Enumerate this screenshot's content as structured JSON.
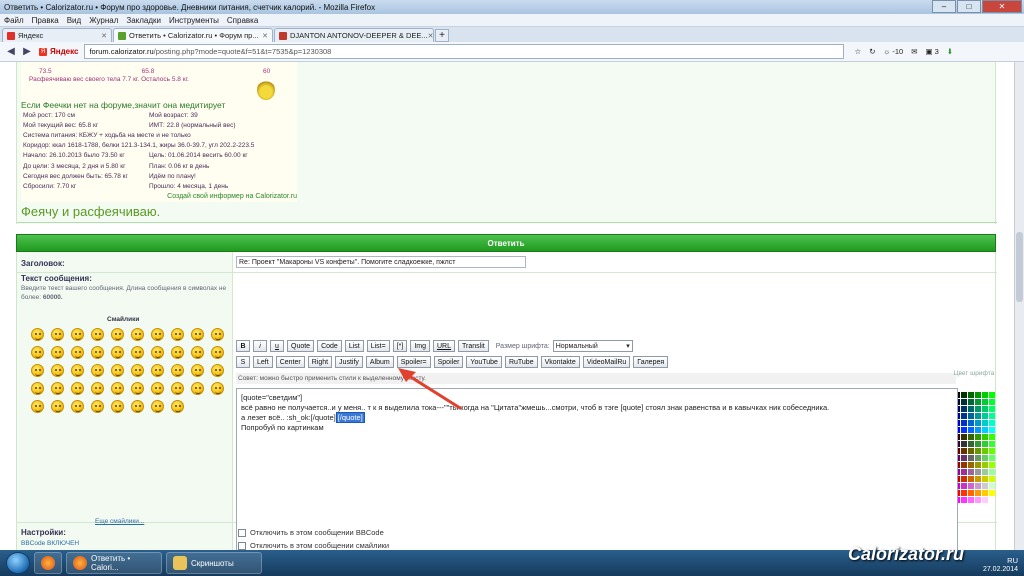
{
  "window": {
    "title": "Ответить • Calorizator.ru • Форум про здоровье. Дневники питания, счетчик калорий. - Mozilla Firefox"
  },
  "menu": [
    "Файл",
    "Правка",
    "Вид",
    "Журнал",
    "Закладки",
    "Инструменты",
    "Справка"
  ],
  "tabs": [
    {
      "label": "Яндекс",
      "favicon_color": "#e0302a"
    },
    {
      "label": "Ответить • Calorizator.ru • Форум пр...",
      "favicon_color": "#5aa02c"
    },
    {
      "label": "DJANTON ANTONOV-DEEPER & DEE...",
      "favicon_color": "#c0392b"
    }
  ],
  "nav": {
    "yandex_label": "Яндекс",
    "url_domain": "forum.calorizator.ru",
    "url_path": "/posting.php?mode=quote&f=51&t=7535&p=1230308",
    "weather": "-10",
    "counter": "3"
  },
  "informer": {
    "scale_left": "73.5",
    "scale_mid": "65.8",
    "scale_right": "60",
    "lose_note": "Расфеячиваю вес своего тела 7.7 кг. Осталось 5.8 кг.",
    "headline": "Если Феечки нет на форуме,значит она медитирует",
    "rows": [
      {
        "l": "Мой рост: 170 см",
        "r": "Мой возраст: 39"
      },
      {
        "l": "Мой текущий вес: 65.8 кг",
        "r": "ИМТ: 22.8 (нормальный вес)"
      },
      {
        "l": "Система питания: КБЖУ + ходьба на месте и не только",
        "r": ""
      },
      {
        "l": "Коридор: ккал 1618-1788, белки 121.3-134.1, жиры 36.0-39.7, угл 202.2-223.5",
        "r": ""
      },
      {
        "l": "Начало: 26.10.2013 было 73.50 кг",
        "r": "Цель: 01.06.2014 весить 60.00 кг"
      },
      {
        "l": "До цели: 3 месяца, 2 дня и 5.80 кг",
        "r": "План: 0.06 кг в день"
      },
      {
        "l": "Сегодня вес должен быть: 65.78 кг",
        "r": "Идём по плану!"
      },
      {
        "l": "Сбросили: 7.70 кг",
        "r": "Прошло: 4 месяца, 1 день"
      }
    ],
    "footer_link": "Создай свой информер на Calorizator.ru"
  },
  "signature_text": "Феячу и расфеячиваю.",
  "reply_header": "Ответить",
  "form": {
    "subject_label": "Заголовок:",
    "subject_value": "Re: Проект \"Макароны VS конфеты\". Помогите сладкоежке, пжлст",
    "message_label": "Текст сообщения:",
    "message_hint": "Введите текст вашего сообщения. Длина сообщения в символах не более:",
    "message_limit": "60000.",
    "smileys_title": "Смайлики",
    "more_smileys": "Еще смайлики...",
    "toolbar_row1": [
      "B",
      "i",
      "u",
      "Quote",
      "Code",
      "List",
      "List=",
      "[*]",
      "Img",
      "URL",
      "Translit"
    ],
    "font_size_label": "Размер шрифта:",
    "font_size_value": "Нормальный",
    "toolbar_row2": [
      "S",
      "Left",
      "Center",
      "Right",
      "Justify",
      "Album",
      "Spoiler=",
      "Spoiler",
      "YouTube",
      "RuTube",
      "Vkontakte",
      "VideoMailRu",
      "Галерея"
    ],
    "tip": "Совет: можно быстро применить стили к выделенному тексту.",
    "colors_label": "Цвет шрифта",
    "editor": {
      "line1": "[quote=\"светдим\"]",
      "line2": "всё равно не получается..и у меня.. т к я выделила тока---\"\"ты когда на \"Цитата\"жмешь...смотри, чтоб в тэге [quote] стоял знак равенства и в кавычках ник собеседника.",
      "line3_a": "а лезет всё.. :sh_ok:[/quote]",
      "line3_sel": "[/quote]",
      "line4": "Попробуй по картинкам"
    },
    "settings_label": "Настройки:",
    "settings_sub": "BBCode ВКЛЮЧЕН",
    "opt1": "Отключить в этом сообщении BBCode",
    "opt2": "Отключить в этом сообщении смайлики"
  },
  "taskbar": {
    "app1": "Ответить • Calori...",
    "app2": "Скриншоты"
  },
  "watermark": "Calorizator.ru",
  "tray": {
    "lang": "RU",
    "time": "",
    "date": "27.02.2014"
  },
  "palette_colors": [
    "#000000",
    "#003300",
    "#006600",
    "#009900",
    "#00cc00",
    "#00ff00",
    "#000033",
    "#003333",
    "#006633",
    "#009933",
    "#00cc33",
    "#00ff33",
    "#000066",
    "#003366",
    "#006666",
    "#009966",
    "#00cc66",
    "#00ff66",
    "#000099",
    "#003399",
    "#006699",
    "#009999",
    "#00cc99",
    "#00ff99",
    "#0000cc",
    "#0033cc",
    "#0066cc",
    "#0099cc",
    "#00cccc",
    "#00ffcc",
    "#0000ff",
    "#0033ff",
    "#0066ff",
    "#0099ff",
    "#00ccff",
    "#00ffff",
    "#330000",
    "#333300",
    "#336600",
    "#339900",
    "#33cc00",
    "#33ff00",
    "#330033",
    "#333333",
    "#336633",
    "#339933",
    "#33cc33",
    "#33ff33",
    "#660000",
    "#663300",
    "#666600",
    "#669900",
    "#66cc00",
    "#66ff00",
    "#660066",
    "#663366",
    "#666666",
    "#669966",
    "#66cc66",
    "#66ff66",
    "#990000",
    "#993300",
    "#996600",
    "#999900",
    "#99cc00",
    "#99ff00",
    "#990099",
    "#993399",
    "#996699",
    "#999999",
    "#99cc99",
    "#99ff99",
    "#cc0000",
    "#cc3300",
    "#cc6600",
    "#cc9900",
    "#cccc00",
    "#ccff00",
    "#cc00cc",
    "#cc33cc",
    "#cc66cc",
    "#cc99cc",
    "#cccccc",
    "#ccffcc",
    "#ff0000",
    "#ff3300",
    "#ff6600",
    "#ff9900",
    "#ffcc00",
    "#ffff00",
    "#ff00ff",
    "#ff33ff",
    "#ff66ff",
    "#ff99ff",
    "#ffccff",
    "#ffffff"
  ]
}
